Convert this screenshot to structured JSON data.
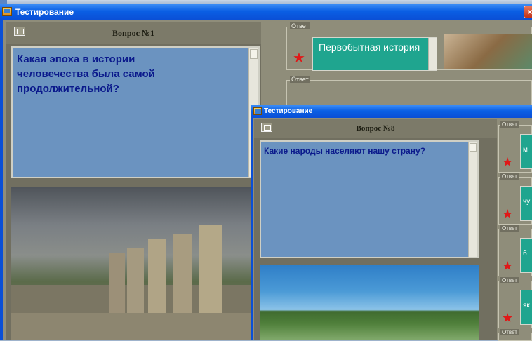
{
  "window1": {
    "title": "Тестирование",
    "question_label": "Вопрос №1",
    "question_text": "Какая эпоха в истории человечества была самой продолжительной?",
    "answers": [
      {
        "group_label": "Ответ",
        "text": "Первобытная история"
      },
      {
        "group_label": "Ответ",
        "text": ""
      }
    ],
    "image_desc": "ancient-ruins-columns"
  },
  "window2": {
    "title": "Тестирование",
    "question_label": "Вопрос №8",
    "question_text": "Какие народы населяют нашу страну?",
    "answers": [
      {
        "group_label": "Ответ",
        "text": "м"
      },
      {
        "group_label": "Ответ",
        "text": "чу"
      },
      {
        "group_label": "Ответ",
        "text": "б"
      },
      {
        "group_label": "Ответ",
        "text": "як"
      },
      {
        "group_label": "Ответ",
        "text": ""
      }
    ],
    "image_desc": "forest-river-landscape"
  },
  "colors": {
    "titlebar": "#0a5fe4",
    "question_bg": "#6b93c0",
    "answer_bg": "#1fa58f",
    "star": "#e01818"
  }
}
